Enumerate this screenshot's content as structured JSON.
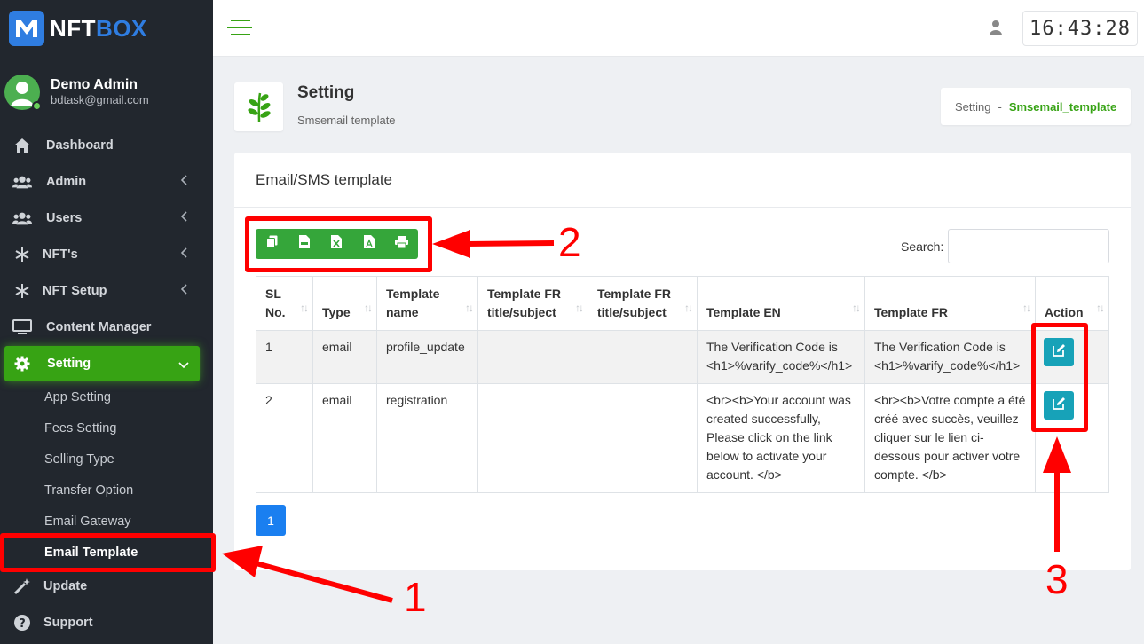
{
  "brand": {
    "name_part1": "NFT",
    "name_part2": "BOX"
  },
  "profile": {
    "name": "Demo Admin",
    "email": "bdtask@gmail.com"
  },
  "nav": {
    "items": [
      {
        "label": "Dashboard",
        "icon": "home-icon"
      },
      {
        "label": "Admin",
        "icon": "users-icon"
      },
      {
        "label": "Users",
        "icon": "users-icon"
      },
      {
        "label": "NFT's",
        "icon": "snowflake-icon"
      },
      {
        "label": "NFT Setup",
        "icon": "snowflake-icon"
      },
      {
        "label": "Content Manager",
        "icon": "monitor-icon"
      },
      {
        "label": "Setting",
        "icon": "gear-icon"
      }
    ],
    "sub_items": [
      "App Setting",
      "Fees Setting",
      "Selling Type",
      "Transfer Option",
      "Email Gateway",
      "Email Template"
    ],
    "bottom_items": [
      {
        "label": "Update",
        "icon": "magic-wand-icon"
      },
      {
        "label": "Support",
        "icon": "help-icon"
      }
    ]
  },
  "topbar": {
    "clock": "16:43:28"
  },
  "page_header": {
    "title": "Setting",
    "subtitle": "Smsemail template"
  },
  "breadcrumb": {
    "parent": "Setting",
    "separator": "-",
    "current": "Smsemail_template"
  },
  "card": {
    "title": "Email/SMS template"
  },
  "search": {
    "label": "Search:",
    "value": ""
  },
  "table": {
    "headers": [
      "SL No.",
      "Type",
      "Template name",
      "Template FR title/subject",
      "Template FR title/subject",
      "Template EN",
      "Template FR",
      "Action"
    ],
    "rows": [
      {
        "sl": "1",
        "type": "email",
        "name": "profile_update",
        "fr_title1": "",
        "fr_title2": "",
        "en": "The Verification Code is <h1>%varify_code%</h1>",
        "fr": "The Verification Code is <h1>%varify_code%</h1>"
      },
      {
        "sl": "2",
        "type": "email",
        "name": "registration",
        "fr_title1": "",
        "fr_title2": "",
        "en": "<br><b>Your account was created successfully, Please click on the link below to activate your account. </b>",
        "fr": "<br><b>Votre compte a été créé avec succès, veuillez cliquer sur le lien ci-dessous pour activer votre compte. </b>"
      }
    ]
  },
  "pagination": {
    "current": "1"
  },
  "annotations": {
    "n1": "1",
    "n2": "2",
    "n3": "3",
    "color": "#ff0000"
  },
  "colors": {
    "accent_green": "#37a314",
    "sidebar_bg": "#22272e",
    "brand_blue": "#2f7de1",
    "edit_btn": "#17a2b8",
    "page_btn": "#1a7ff0"
  }
}
